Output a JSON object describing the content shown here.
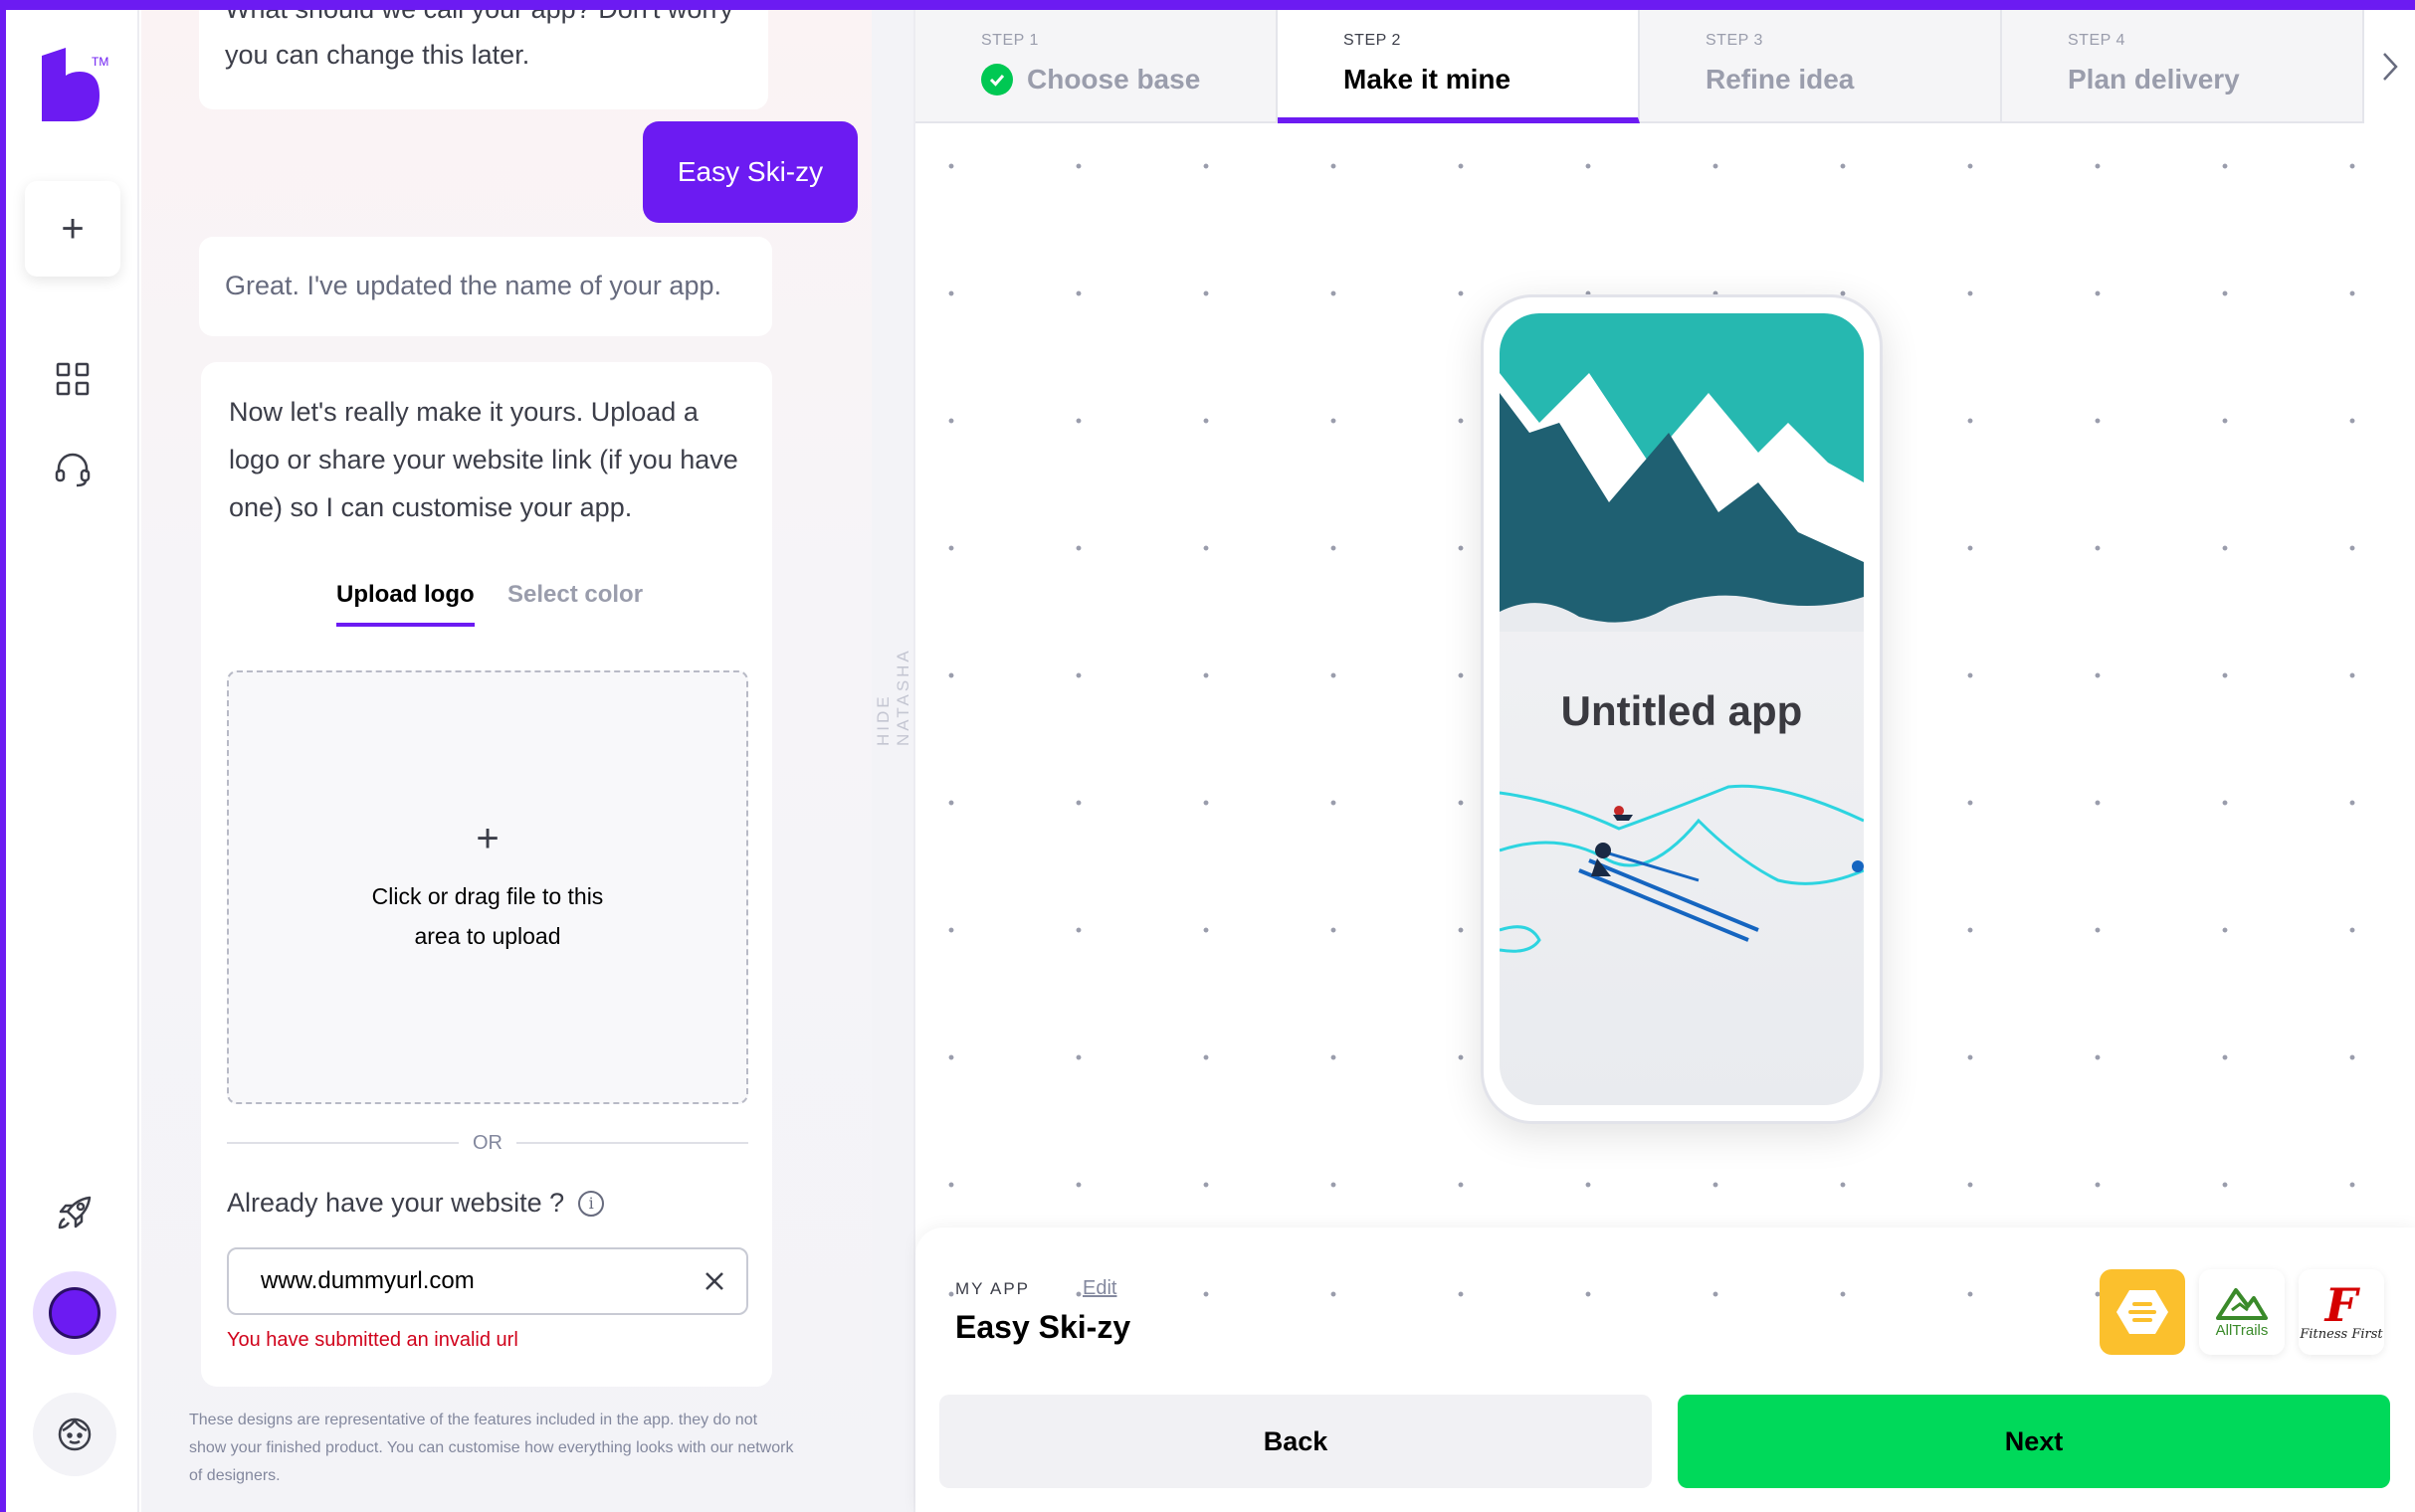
{
  "colors": {
    "brand": "#6c1bf2",
    "next": "#00d95a",
    "error": "#d0021b",
    "success": "#00c853"
  },
  "rail": {
    "icons": [
      "plus-icon",
      "grid-icon",
      "headset-icon",
      "rocket-icon",
      "avatar",
      "face-icon"
    ]
  },
  "chat": {
    "question": "What should we call your app? Don't worry you can change this later.",
    "user_reply": "Easy Ski-zy",
    "ack": "Great. I've updated the name of your app.",
    "intro": "Now let's really make it yours. Upload a logo or share your website link (if you have one) so I can customise your app.",
    "tabs": [
      {
        "label": "Upload logo",
        "active": true
      },
      {
        "label": "Select color",
        "active": false
      }
    ],
    "dropzone_text": "Click or drag file to this area to upload",
    "or_label": "OR",
    "website_label": "Already have your website ?",
    "url_value": "www.dummyurl.com",
    "url_error": "You have submitted an invalid url",
    "disclaimer": "These designs are representative of the features included in the app. they do not show  your finished product. You can customise how everything looks with our network of designers."
  },
  "divider": {
    "label": "HIDE NATASHA"
  },
  "stepper": {
    "steps": [
      {
        "num": "STEP 1",
        "title": "Choose base",
        "state": "done"
      },
      {
        "num": "STEP 2",
        "title": "Make it mine",
        "state": "active"
      },
      {
        "num": "STEP 3",
        "title": "Refine idea",
        "state": "upcoming"
      },
      {
        "num": "STEP 4",
        "title": "Plan delivery",
        "state": "upcoming"
      }
    ]
  },
  "preview": {
    "app_title": "Untitled app"
  },
  "sheet": {
    "my_app_label": "MY APP",
    "edit_label": "Edit",
    "app_name": "Easy Ski-zy",
    "brands": [
      {
        "name": "bumble-logo"
      },
      {
        "name": "alltrails-logo",
        "label": "AllTrails"
      },
      {
        "name": "fitness-first-logo",
        "label": "Fitness First"
      }
    ],
    "back_label": "Back",
    "next_label": "Next"
  }
}
